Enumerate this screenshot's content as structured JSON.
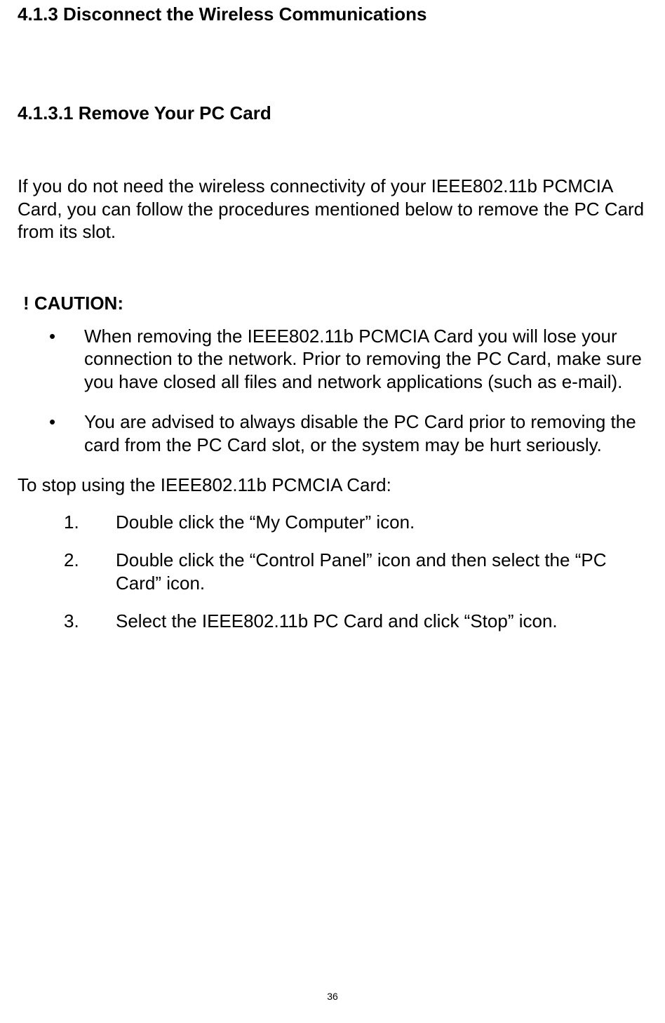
{
  "heading1": "4.1.3 Disconnect the Wireless Communications",
  "heading2": "4.1.3.1 Remove Your PC Card",
  "paragraph1": "If you do not need the wireless connectivity of your IEEE802.11b PCMCIA Card, you can follow the procedures mentioned below to remove the PC Card from its slot.",
  "cautionHeading": "! CAUTION:",
  "bullets": [
    "When removing the IEEE802.11b PCMCIA Card you will lose your connection to the network. Prior to removing the PC Card, make sure you have closed all files and network applications (such as e-mail).",
    "You are advised to always disable the PC Card prior to removing the card from the PC Card slot, or the system may be hurt seriously."
  ],
  "introLine": "To stop using the IEEE802.11b PCMCIA Card:",
  "steps": [
    {
      "num": "1.",
      "text": "Double click the “My Computer” icon."
    },
    {
      "num": "2.",
      "text": "Double click the “Control Panel” icon and then select the “PC Card” icon."
    },
    {
      "num": "3.",
      "text": "Select the IEEE802.11b PC Card and click “Stop” icon."
    }
  ],
  "pageNumber": "36"
}
